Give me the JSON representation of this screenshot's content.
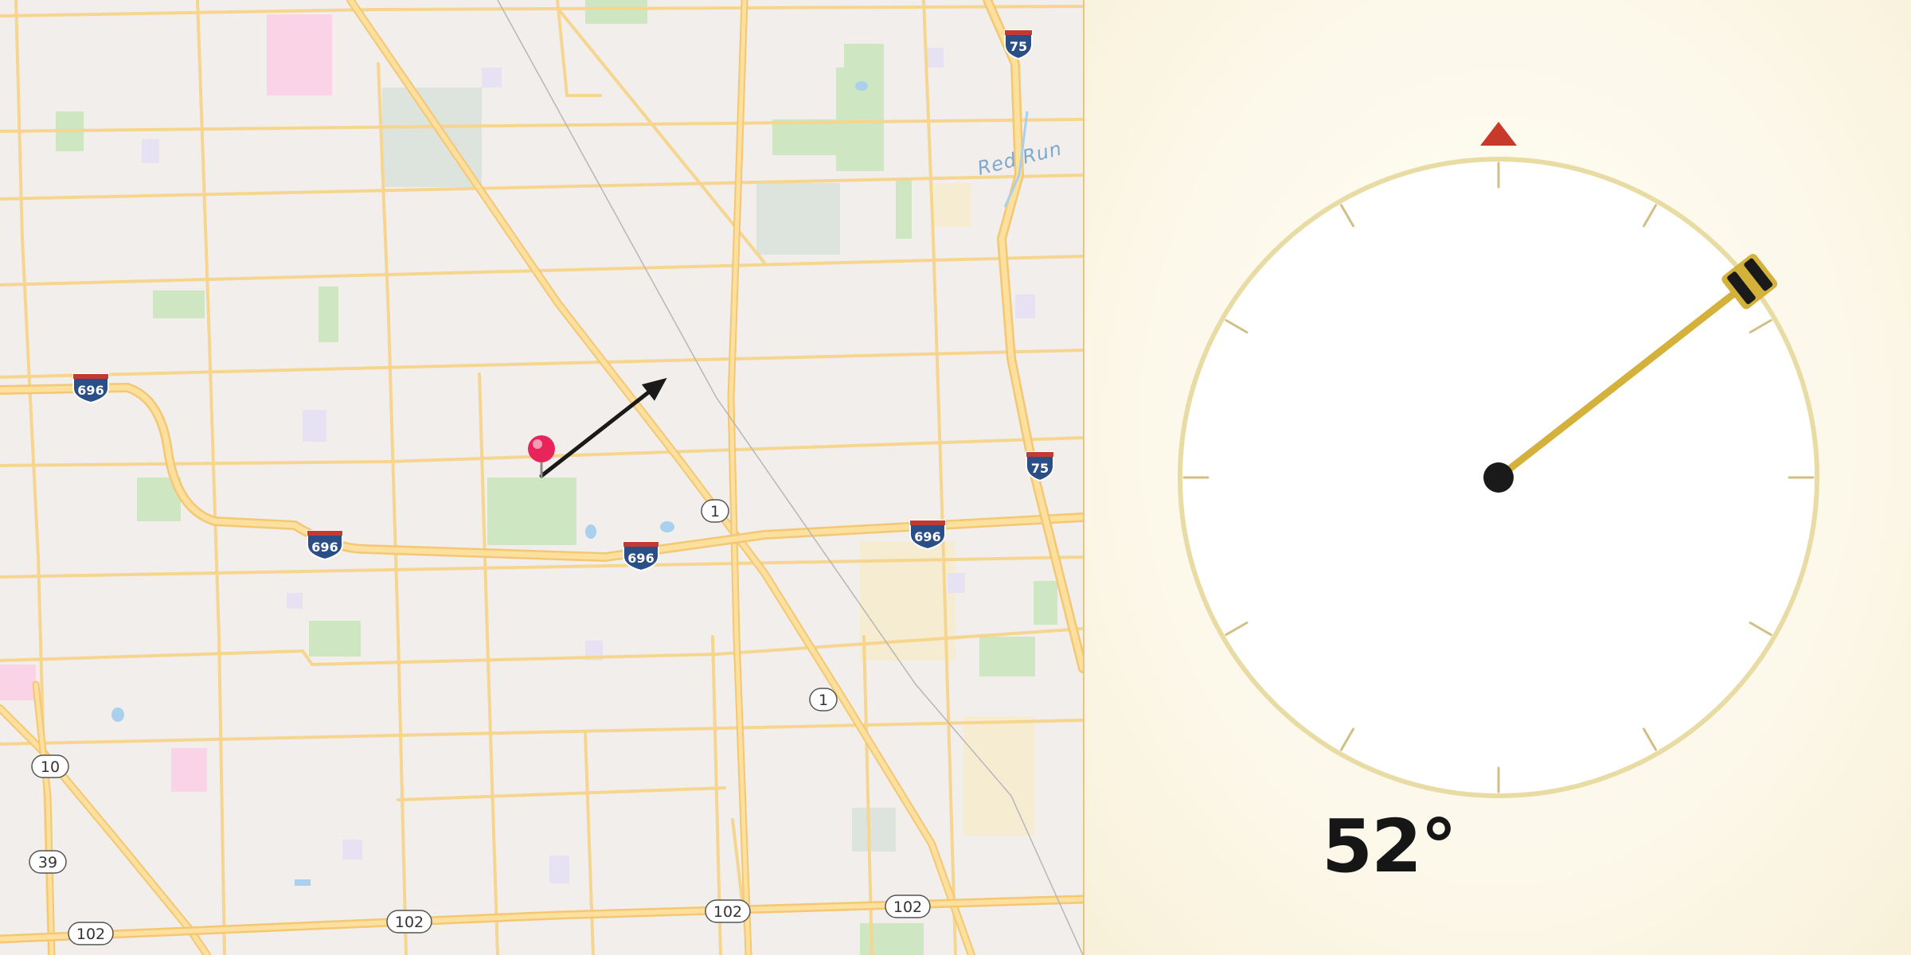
{
  "map": {
    "water_label": "Red Run",
    "shields": {
      "i75_top": "75",
      "i75_right": "75",
      "i696_left": "696",
      "i696_mid_left": "696",
      "i696_mid": "696",
      "i696_right": "696"
    },
    "routes": {
      "r1_upper": "1",
      "r1_lower": "1",
      "r10": "10",
      "r39": "39",
      "r102_a": "102",
      "r102_b": "102",
      "r102_c": "102",
      "r102_d": "102"
    },
    "pin_color": "#e8255a",
    "arrow_color": "#1a1a1a"
  },
  "compass": {
    "heading_deg": 52,
    "heading_label": "52°",
    "north_marker_color": "#c8392b",
    "needle_color": "#d4b13a",
    "ring_color": "#e8dca4"
  }
}
